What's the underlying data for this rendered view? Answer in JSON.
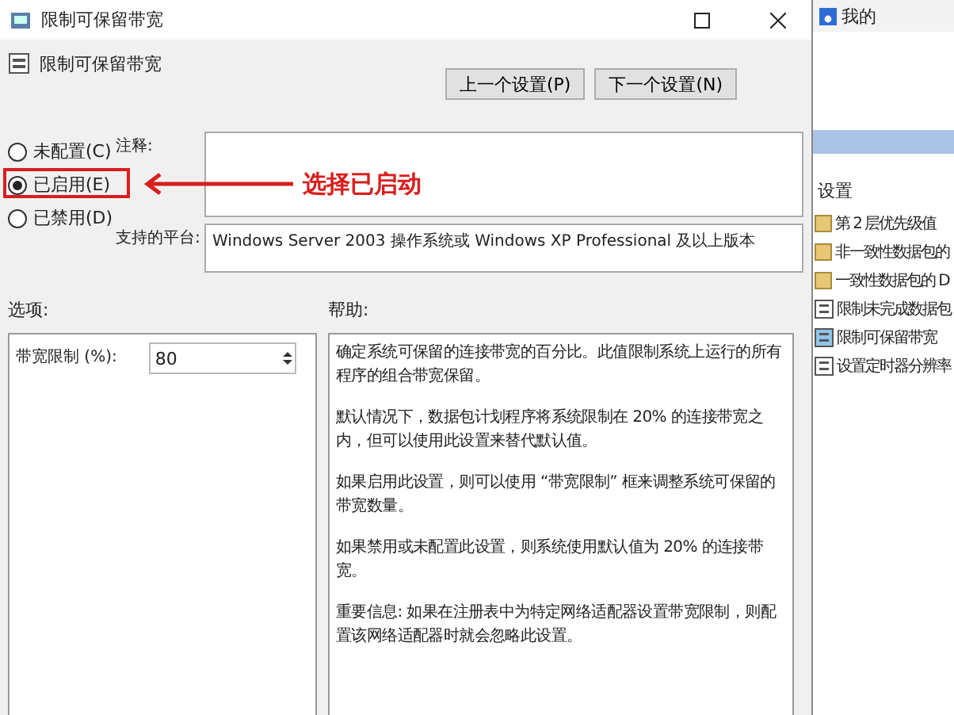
{
  "window": {
    "title": "限制可保留带宽"
  },
  "header": {
    "title": "限制可保留带宽",
    "buttons": [
      "上一个设置(P)",
      "下一个设置(N)"
    ]
  },
  "states": [
    {
      "label": "未配置(C)",
      "selected": false
    },
    {
      "label": "已启用(E)",
      "selected": true
    },
    {
      "label": "已禁用(D)",
      "selected": false
    }
  ],
  "annotation": {
    "text": "选择已启动"
  },
  "comment": {
    "label": "注释:"
  },
  "platform": {
    "label": "支持的平台:",
    "value": "Windows Server 2003 操作系统或 Windows XP Professional 及以上版本"
  },
  "options": {
    "label": "选项:",
    "field_label": "带宽限制 (%):",
    "value": "80"
  },
  "help": {
    "label": "帮助:",
    "paragraphs": [
      "确定系统可保留的连接带宽的百分比。此值限制系统上运行的所有程序的组合带宽保留。",
      "默认情况下，数据包计划程序将系统限制在 20% 的连接带宽之内，但可以使用此设置来替代默认值。",
      "如果启用此设置，则可以使用 “带宽限制” 框来调整系统可保留的带宽数量。",
      "如果禁用或未配置此设置，则系统使用默认值为 20% 的连接带宽。",
      "重要信息: 如果在注册表中为特定网络适配器设置带宽限制，则配置该网络适配器时就会忽略此设置。"
    ]
  },
  "background_window": {
    "tab": "我的",
    "list_heading": "设置",
    "items": [
      {
        "label": "第 2 层优先级值",
        "kind": "folder",
        "selected": false
      },
      {
        "label": "非一致性数据包的",
        "kind": "folder",
        "selected": false
      },
      {
        "label": "一致性数据包的 D",
        "kind": "folder",
        "selected": false
      },
      {
        "label": "限制未完成数据包",
        "kind": "policy",
        "selected": false
      },
      {
        "label": "限制可保留带宽",
        "kind": "policy",
        "selected": true
      },
      {
        "label": "设置定时器分辨率",
        "kind": "policy",
        "selected": false
      }
    ]
  }
}
